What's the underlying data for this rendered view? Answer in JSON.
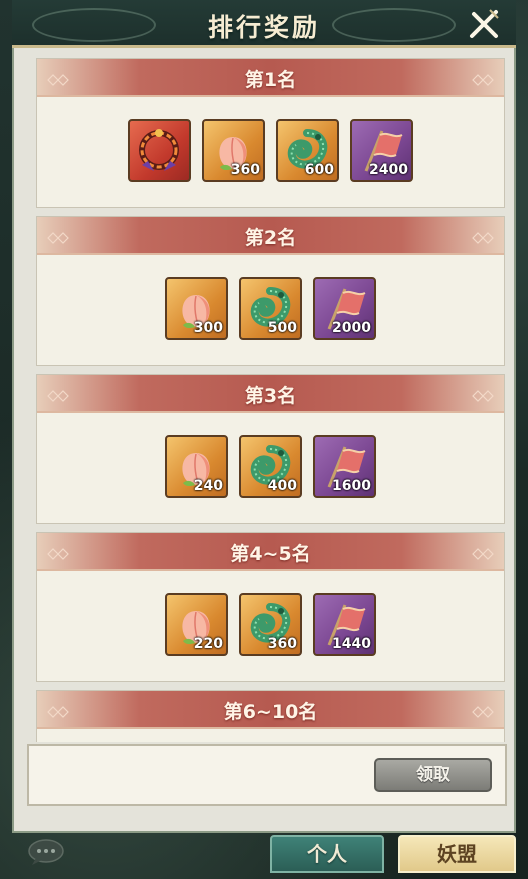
{
  "title": "排行奖励",
  "ranks": [
    {
      "label": "第1名",
      "items": [
        {
          "icon": "ring-icon",
          "frame": "red",
          "qty": ""
        },
        {
          "icon": "peach-icon",
          "frame": "orange",
          "qty": "360"
        },
        {
          "icon": "jade-dragon-icon",
          "frame": "orange",
          "qty": "600"
        },
        {
          "icon": "banner-flag-icon",
          "frame": "purple",
          "qty": "2400"
        }
      ]
    },
    {
      "label": "第2名",
      "items": [
        {
          "icon": "peach-icon",
          "frame": "orange",
          "qty": "300"
        },
        {
          "icon": "jade-dragon-icon",
          "frame": "orange",
          "qty": "500"
        },
        {
          "icon": "banner-flag-icon",
          "frame": "purple",
          "qty": "2000"
        }
      ]
    },
    {
      "label": "第3名",
      "items": [
        {
          "icon": "peach-icon",
          "frame": "orange",
          "qty": "240"
        },
        {
          "icon": "jade-dragon-icon",
          "frame": "orange",
          "qty": "400"
        },
        {
          "icon": "banner-flag-icon",
          "frame": "purple",
          "qty": "1600"
        }
      ]
    },
    {
      "label": "第4~5名",
      "items": [
        {
          "icon": "peach-icon",
          "frame": "orange",
          "qty": "220"
        },
        {
          "icon": "jade-dragon-icon",
          "frame": "orange",
          "qty": "360"
        },
        {
          "icon": "banner-flag-icon",
          "frame": "purple",
          "qty": "1440"
        }
      ]
    },
    {
      "label": "第6~10名",
      "items": []
    }
  ],
  "claim_button": "领取",
  "tabs": {
    "personal": "个人",
    "alliance": "妖盟"
  },
  "colors": {
    "header_red": "#b65a50",
    "orange_frame": "#d9892f",
    "purple_frame": "#7a4691",
    "active_tab": "#e1c98a"
  }
}
